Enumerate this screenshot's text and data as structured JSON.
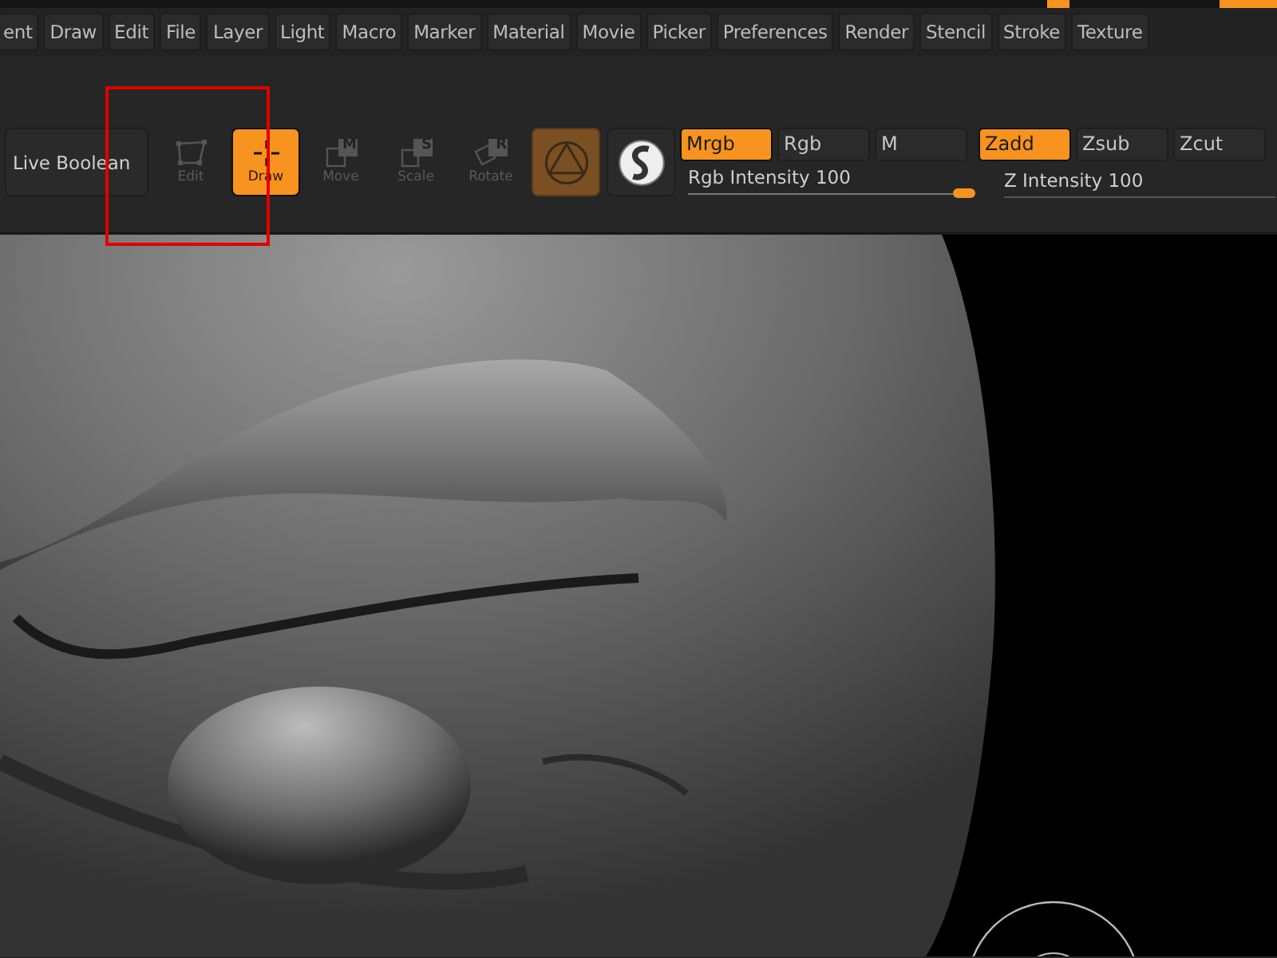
{
  "menu_bar": {
    "items": [
      "ent",
      "Draw",
      "Edit",
      "File",
      "Layer",
      "Light",
      "Macro",
      "Marker",
      "Material",
      "Movie",
      "Picker",
      "Preferences",
      "Render",
      "Stencil",
      "Stroke",
      "Texture"
    ]
  },
  "toolbar": {
    "live_boolean": {
      "label": "Live Boolean"
    },
    "tools": [
      {
        "kind": "edit",
        "label": "Edit",
        "selected": false,
        "disabled": true
      },
      {
        "kind": "draw",
        "label": "Draw",
        "selected": true,
        "disabled": false
      },
      {
        "kind": "move",
        "label": "Move",
        "badge": "M",
        "selected": false,
        "disabled": true
      },
      {
        "kind": "scale",
        "label": "Scale",
        "badge": "S",
        "selected": false,
        "disabled": true
      },
      {
        "kind": "rotate",
        "label": "Rotate",
        "badge": "R",
        "selected": false,
        "disabled": true
      }
    ],
    "material_button": {
      "selected": true
    },
    "color_modes": [
      {
        "label": "Mrgb",
        "selected": true
      },
      {
        "label": "Rgb",
        "selected": false
      },
      {
        "label": "M",
        "selected": false
      }
    ],
    "depth_modes": [
      {
        "label": "Zadd",
        "selected": true
      },
      {
        "label": "Zsub",
        "selected": false
      },
      {
        "label": "Zcut",
        "selected": false
      }
    ],
    "rgb_intensity": {
      "label": "Rgb Intensity",
      "reading": "100",
      "level": 1
    },
    "z_intensity": {
      "label": "Z Intensity",
      "reading": "100"
    }
  }
}
